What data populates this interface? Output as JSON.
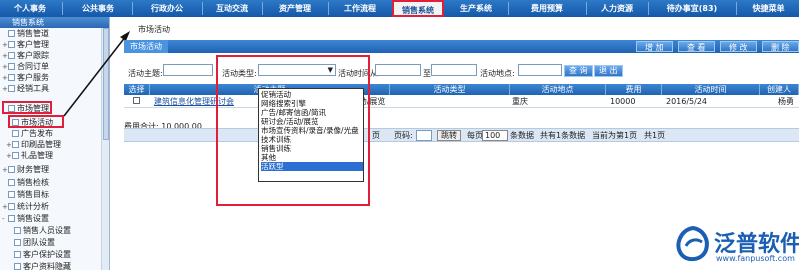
{
  "nav": {
    "items": [
      "个人事务",
      "公共事务",
      "行政办公",
      "互动交流",
      "资产管理",
      "工作流程",
      "销售系统",
      "生产系统",
      "费用预算",
      "人力资源",
      "待办事宜(83)",
      "快捷菜单"
    ]
  },
  "sidebar": {
    "header": "销售系统",
    "items": [
      "销售管道",
      "客户管理",
      "客户跟踪",
      "合同订单",
      "客户服务",
      "经销工具",
      "市场管理",
      "市场活动",
      "广告发布",
      "印刷品管理",
      "礼品管理",
      "财务管理",
      "销售检核",
      "销售目标",
      "统计分析",
      "销售设置",
      "销售人员设置",
      "团队设置",
      "客户保护设置",
      "客户资料隐藏"
    ]
  },
  "breadcrumb": "市场活动",
  "tab": "市场活动",
  "toolbar": {
    "add": "增 加",
    "view": "查 看",
    "edit": "修 改",
    "delete": "删 除"
  },
  "filters": {
    "subject_label": "活动主题:",
    "type_label": "活动类型:",
    "time_label": "活动时间从",
    "to_label": "至",
    "place_label": "活动地点:",
    "query_button": "查 询",
    "exit_button": "退 出"
  },
  "table": {
    "headers": [
      "选择",
      "活动主题",
      "活动类型",
      "活动地点",
      "费用",
      "活动时间",
      "创建人"
    ],
    "rows": [
      {
        "subject": "建筑信息化管理研讨会",
        "type": "研讨会/活动/展览",
        "place": "重庆",
        "cost": "10000",
        "date": "2016/5/24",
        "creator": "杨勇"
      }
    ]
  },
  "total": "费用合计: 10,000.00",
  "pager": {
    "prev_text": "页",
    "page_label": "页码:",
    "jump_button": "跳转",
    "per_page_label": "每页",
    "per_page_value": "100",
    "per_page_unit": "条数据",
    "count_text": "共有1条数据",
    "current_text": "当前为第1页",
    "total_pages": "共1页"
  },
  "dropdown_options": [
    "促销活动",
    "网络搜索引擎",
    "广告/邮寄信函/简讯",
    "研讨会/活动/展览",
    "市场宣传资料/录音/录像/光盘",
    "技术训练",
    "销售训练",
    "其他",
    "活跃型"
  ],
  "dropdown_selected": "活跃型",
  "logo": {
    "name": "泛普软件",
    "url": "www.fanpusoft.com"
  },
  "colors": {
    "nav_blue": "#1558a8",
    "highlight_red": "#e0203a",
    "selected_blue": "#2a6fd1"
  }
}
